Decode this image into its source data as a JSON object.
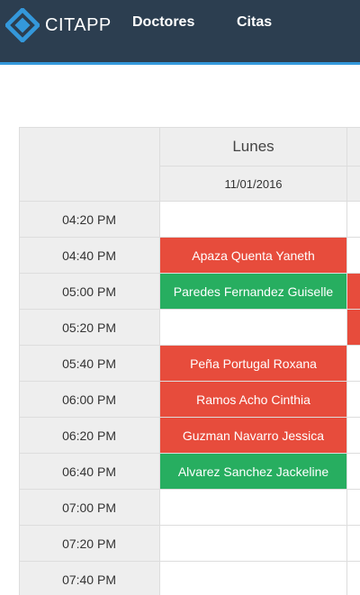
{
  "nav": {
    "brand": "CITAPP",
    "links": [
      "Doctores",
      "Citas"
    ]
  },
  "schedule": {
    "day": "Lunes",
    "date": "11/01/2016",
    "slots": [
      {
        "time": "04:20 PM",
        "patient": "",
        "status": "empty"
      },
      {
        "time": "04:40 PM",
        "patient": "Apaza Quenta Yaneth",
        "status": "red"
      },
      {
        "time": "05:00 PM",
        "patient": "Paredes Fernandez Guiselle",
        "status": "green"
      },
      {
        "time": "05:20 PM",
        "patient": "",
        "status": "empty"
      },
      {
        "time": "05:40 PM",
        "patient": "Peña Portugal Roxana",
        "status": "red"
      },
      {
        "time": "06:00 PM",
        "patient": "Ramos Acho Cinthia",
        "status": "red"
      },
      {
        "time": "06:20 PM",
        "patient": "Guzman Navarro Jessica",
        "status": "red"
      },
      {
        "time": "06:40 PM",
        "patient": "Alvarez Sanchez Jackeline",
        "status": "green"
      },
      {
        "time": "07:00 PM",
        "patient": "",
        "status": "empty"
      },
      {
        "time": "07:20 PM",
        "patient": "",
        "status": "empty"
      },
      {
        "time": "07:40 PM",
        "patient": "",
        "status": "empty"
      }
    ]
  },
  "colors": {
    "navbar": "#2c3e50",
    "accent": "#3498db",
    "booked_red": "#e74c3c",
    "booked_green": "#27ae60"
  }
}
